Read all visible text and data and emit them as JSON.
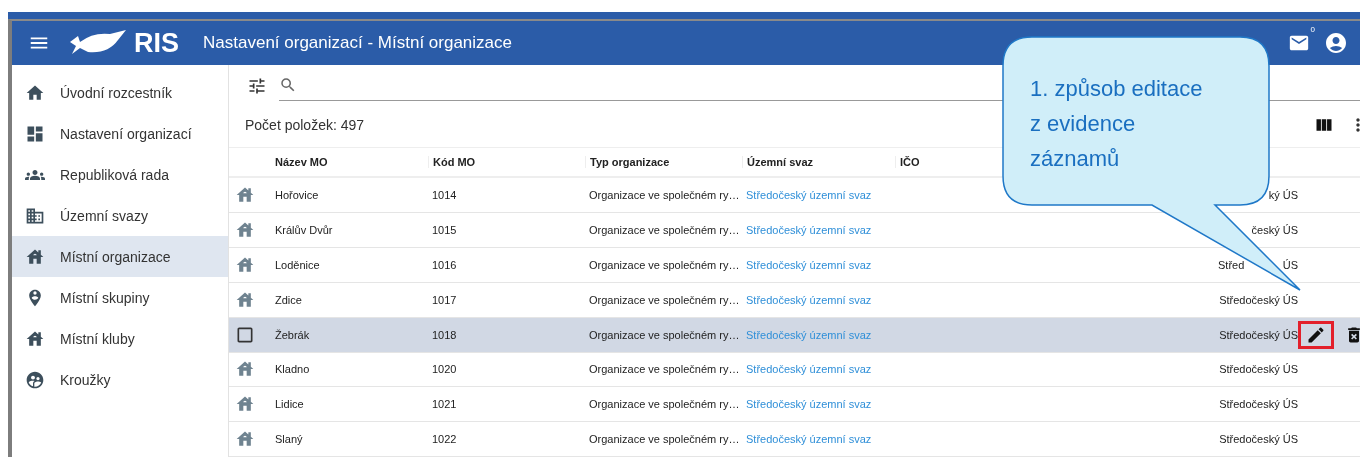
{
  "app_bar": {
    "logo": "RIS",
    "title": "Nastavení organizací - Místní organizace",
    "mail_count": "0"
  },
  "sidebar": {
    "items": [
      {
        "label": "Úvodní rozcestník",
        "selected": false
      },
      {
        "label": "Nastavení organizací",
        "selected": false
      },
      {
        "label": "Republiková rada",
        "selected": false
      },
      {
        "label": "Územní svazy",
        "selected": false
      },
      {
        "label": "Místní organizace",
        "selected": true
      },
      {
        "label": "Místní skupiny",
        "selected": false
      },
      {
        "label": "Místní kluby",
        "selected": false
      },
      {
        "label": "Kroužky",
        "selected": false
      }
    ]
  },
  "toolbar": {
    "count": "Počet položek: 497"
  },
  "table": {
    "columns": [
      "Název MO",
      "Kód MO",
      "Typ organizace",
      "Územní svaz",
      "IČO"
    ],
    "rows": [
      {
        "name": "Hořovice",
        "code": "1014",
        "type": "Organizace ve společném ry…",
        "union": "Středočeský územní svaz",
        "column_6": [
          "ký ÚS"
        ],
        "selected": false
      },
      {
        "name": "Králův Dvůr",
        "code": "1015",
        "type": "Organizace ve společném ry…",
        "union": "Středočeský územní svaz",
        "column_6": [
          "český ÚS"
        ],
        "selected": false
      },
      {
        "name": "Loděnice",
        "code": "1016",
        "type": "Organizace ve společném ry…",
        "union": "Středočeský územní svaz",
        "column_6": [
          "Střed",
          "ÚS"
        ],
        "selected": false
      },
      {
        "name": "Zdice",
        "code": "1017",
        "type": "Organizace ve společném ry…",
        "union": "Středočeský územní svaz",
        "column_6": [
          "Středočeský ÚS"
        ],
        "selected": false
      },
      {
        "name": "Žebrák",
        "code": "1018",
        "type": "Organizace ve společném ry…",
        "union": "Středočeský územní svaz",
        "column_6": [
          "Středočeský ÚS"
        ],
        "selected": true
      },
      {
        "name": "Kladno",
        "code": "1020",
        "type": "Organizace ve společném ry…",
        "union": "Středočeský územní svaz",
        "column_6": [
          "Středočeský ÚS"
        ],
        "selected": false
      },
      {
        "name": "Lidice",
        "code": "1021",
        "type": "Organizace ve společném ry…",
        "union": "Středočeský územní svaz",
        "column_6": [
          "Středočeský ÚS"
        ],
        "selected": false
      },
      {
        "name": "Slaný",
        "code": "1022",
        "type": "Organizace ve společném ry…",
        "union": "Středočeský územní svaz",
        "column_6": [
          "Středočeský ÚS"
        ],
        "selected": false
      }
    ]
  },
  "callout": {
    "lines": [
      "1. způsob editace",
      "z evidence",
      "záznamů"
    ]
  }
}
